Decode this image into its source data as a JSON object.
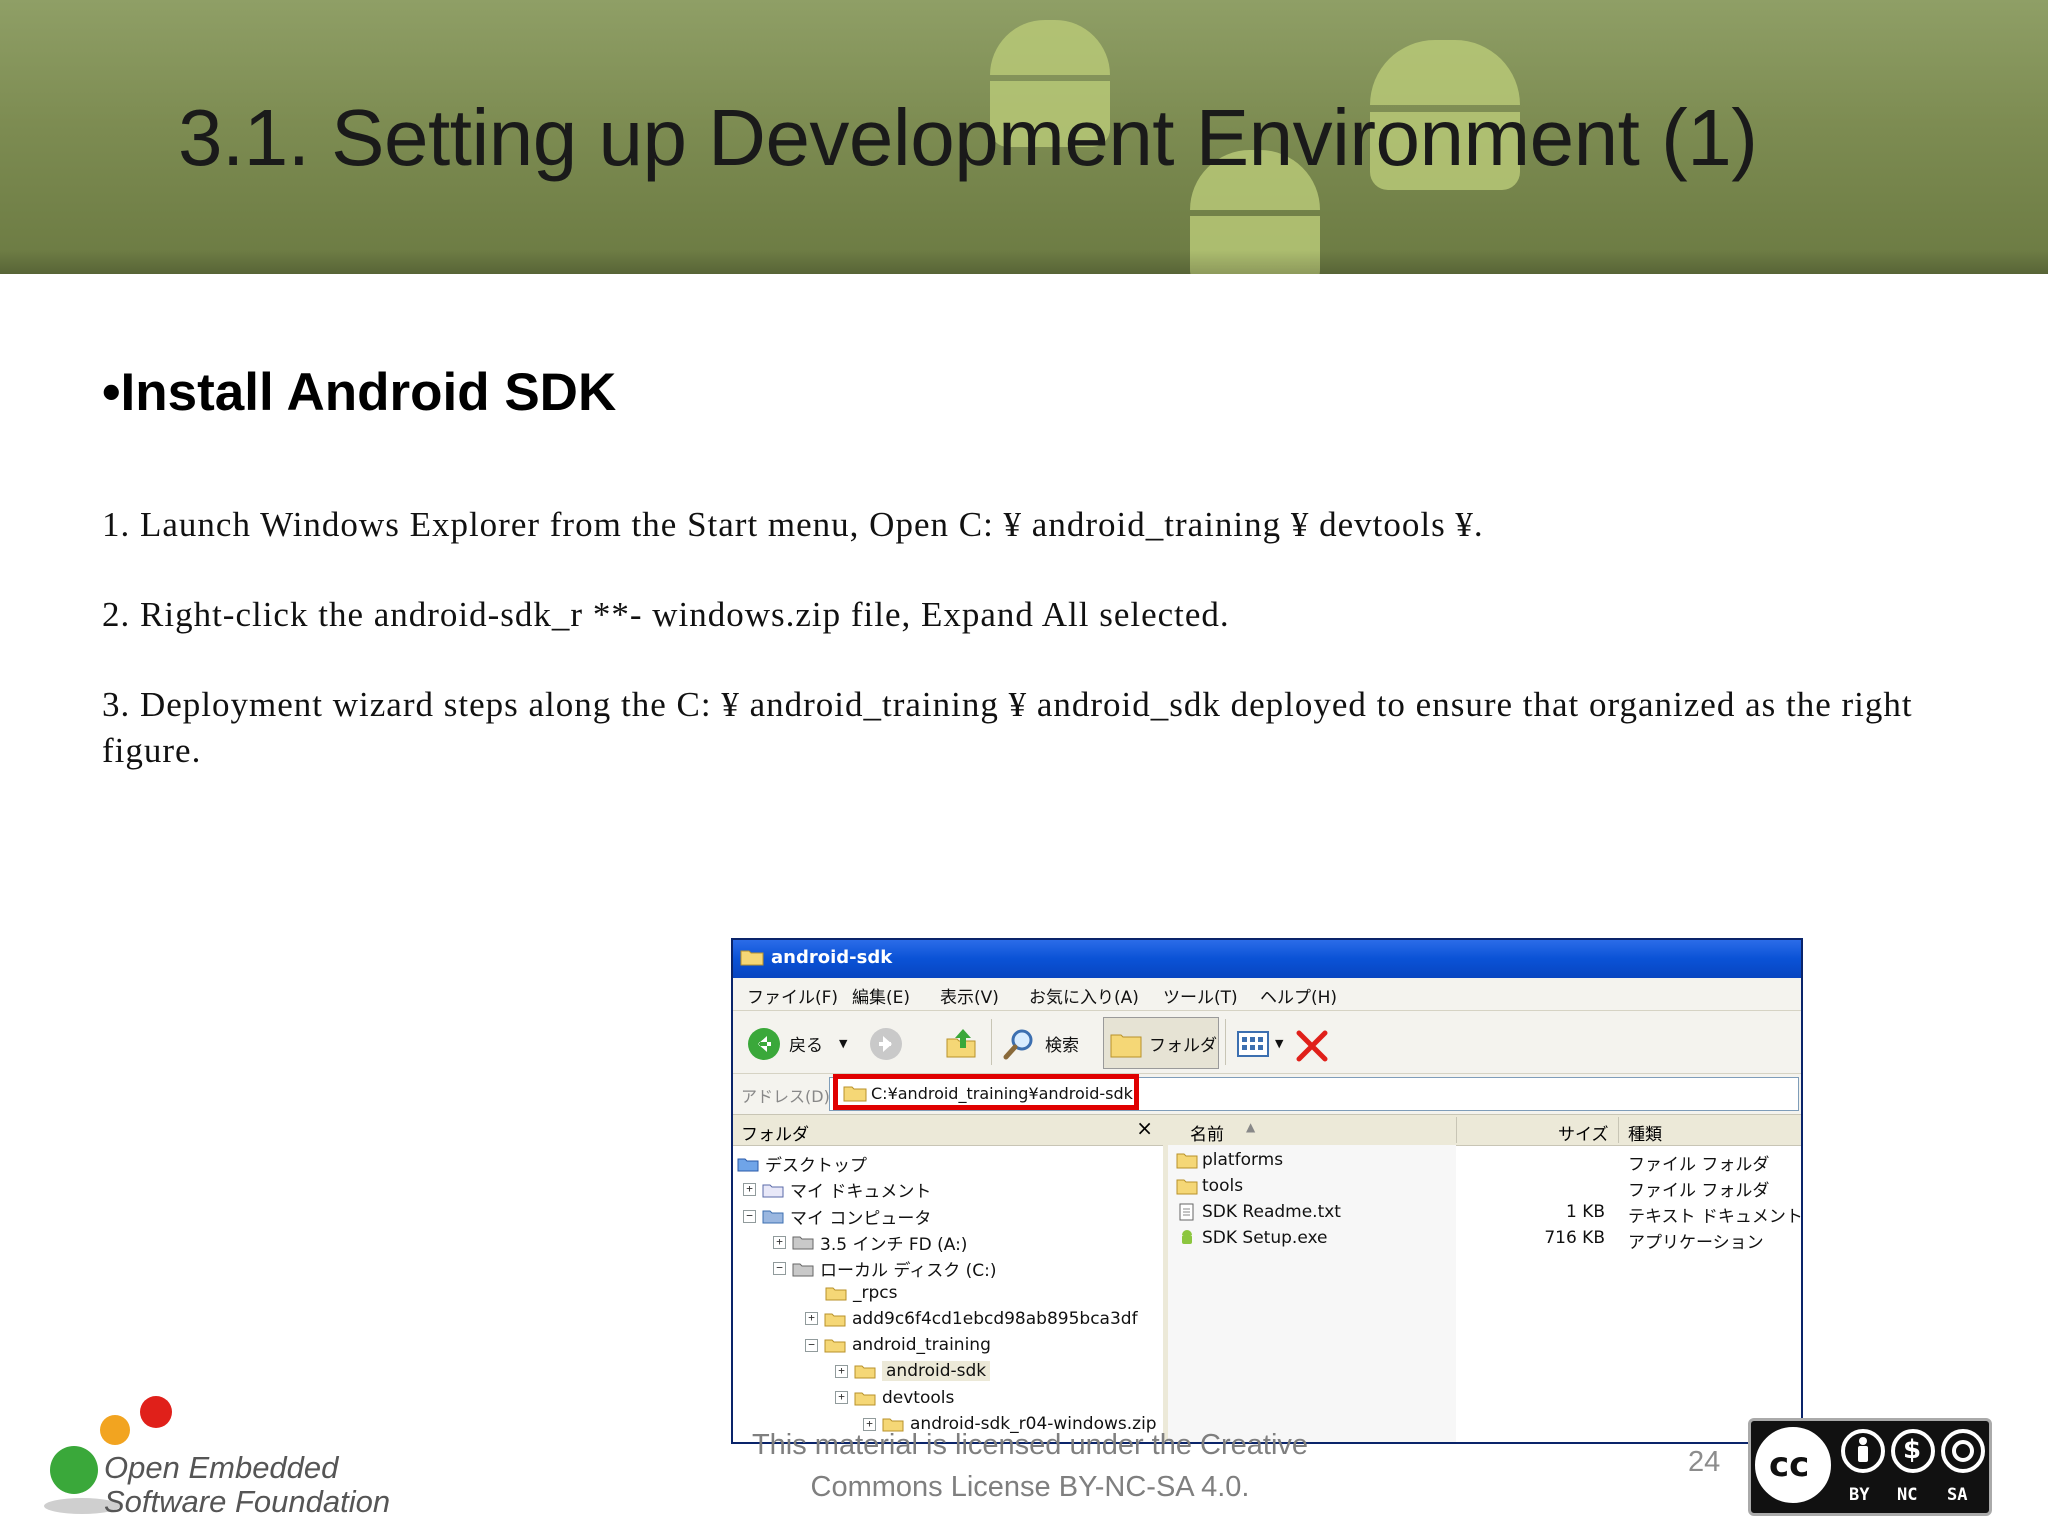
{
  "slide": {
    "title": "3.1. Setting up Development Environment (1)",
    "heading": "•Install Android SDK",
    "steps": [
      "1. Launch Windows Explorer from the Start menu, Open C: ¥ android_training ¥ devtools ¥.",
      "2. Right-click the android-sdk_r **- windows.zip file, Expand All selected.",
      "3. Deployment wizard steps along the C: ¥ android_training ¥ android_sdk deployed to ensure that organized as the right figure."
    ],
    "license_line1": "This material is licensed under the Creative",
    "license_line2": "Commons License BY-NC-SA 4.0.",
    "page_number": "24"
  },
  "logo": {
    "line1": "Open Embedded",
    "line2": "Software Foundation"
  },
  "cc_badge": {
    "cc": "cc",
    "by": "BY",
    "nc": "NC",
    "sa": "SA"
  },
  "explorer": {
    "window_title": "android-sdk",
    "menu": [
      "ファイル(F)",
      "編集(E)",
      "表示(V)",
      "お気に入り(A)",
      "ツール(T)",
      "ヘルプ(H)"
    ],
    "toolbar": {
      "back": "戻る",
      "search": "検索",
      "folders": "フォルダ"
    },
    "address_label": "アドレス(D)",
    "address_value": "C:¥android_training¥android-sdk",
    "left_pane_title": "フォルダ",
    "close_glyph": "×",
    "tree": [
      {
        "label": "デスクトップ",
        "expander": ""
      },
      {
        "label": "マイ ドキュメント",
        "expander": "+"
      },
      {
        "label": "マイ コンピュータ",
        "expander": "−"
      },
      {
        "label": "3.5 インチ FD (A:)",
        "expander": "+"
      },
      {
        "label": "ローカル ディスク (C:)",
        "expander": "−"
      },
      {
        "label": "_rpcs",
        "expander": ""
      },
      {
        "label": "add9c6f4cd1ebcd98ab895bca3df",
        "expander": "+"
      },
      {
        "label": "android_training",
        "expander": "−"
      },
      {
        "label": "android-sdk",
        "expander": "+"
      },
      {
        "label": "devtools",
        "expander": "+"
      },
      {
        "label": "android-sdk_r04-windows.zip",
        "expander": "+"
      }
    ],
    "columns": {
      "name": "名前",
      "size": "サイズ",
      "type": "種類"
    },
    "files": [
      {
        "name": "platforms",
        "size": "",
        "type": "ファイル フォルダ",
        "icon": "folder-icon"
      },
      {
        "name": "tools",
        "size": "",
        "type": "ファイル フォルダ",
        "icon": "folder-icon"
      },
      {
        "name": "SDK Readme.txt",
        "size": "1 KB",
        "type": "テキスト ドキュメント",
        "icon": "text-file-icon"
      },
      {
        "name": "SDK Setup.exe",
        "size": "716 KB",
        "type": "アプリケーション",
        "icon": "android-app-icon"
      }
    ]
  }
}
